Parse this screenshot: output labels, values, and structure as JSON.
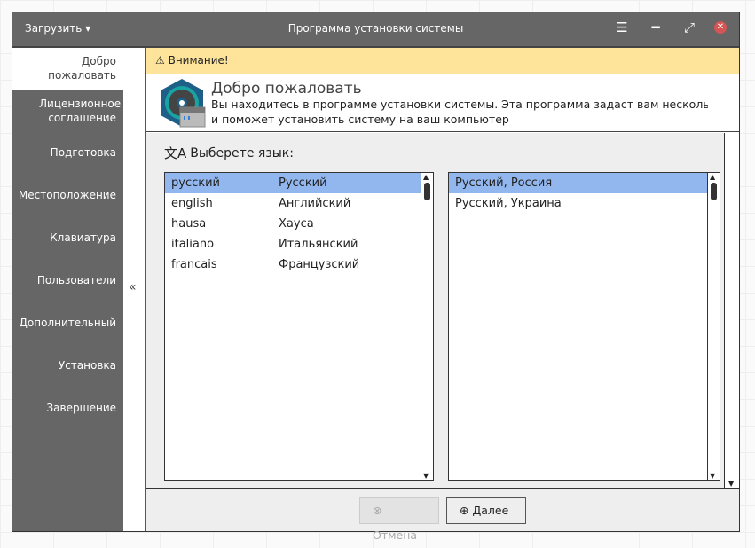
{
  "titlebar": {
    "load_label": "Загрузить",
    "title": "Программа установки системы"
  },
  "sidebar": {
    "items": [
      {
        "label": "Добро пожаловать",
        "active": true
      },
      {
        "label": "Лицензионное соглашение"
      },
      {
        "label": "Подготовка"
      },
      {
        "label": "Местоположение"
      },
      {
        "label": "Клавиатура"
      },
      {
        "label": "Пользователи"
      },
      {
        "label": "Дополнительный"
      },
      {
        "label": "Установка"
      },
      {
        "label": "Завершение"
      }
    ],
    "collapse_label": "«"
  },
  "alert": {
    "text": "Внимание!"
  },
  "header": {
    "title": "Добро пожаловать",
    "line1": "Вы находитесь в программе установки системы. Эта программа задаст вам несколько вопросов",
    "line2": "и поможет установить систему на ваш компьютер"
  },
  "language": {
    "label": "Выберете язык:",
    "languages": [
      {
        "native": "русский",
        "localized": "Русский",
        "selected": true
      },
      {
        "native": "english",
        "localized": "Английский"
      },
      {
        "native": "hausa",
        "localized": "Хауса"
      },
      {
        "native": "italiano",
        "localized": "Итальянский"
      },
      {
        "native": "francais",
        "localized": "Французский"
      }
    ],
    "locales": [
      {
        "label": "Русский, Россия",
        "selected": true
      },
      {
        "label": "Русский, Украина"
      }
    ]
  },
  "footer": {
    "cancel_label": "Отмена",
    "next_label": "Далее"
  }
}
